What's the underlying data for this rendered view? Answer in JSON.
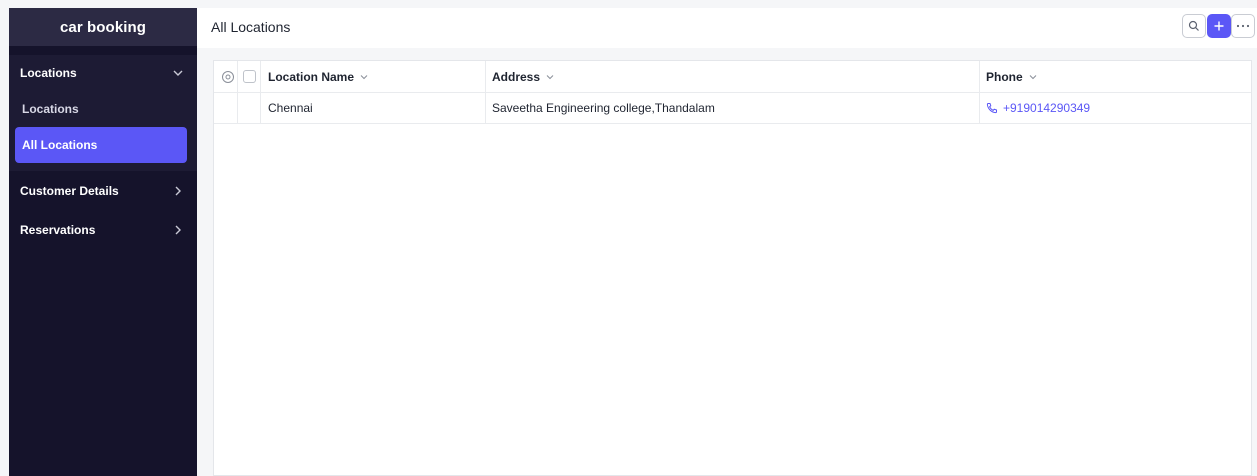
{
  "app": {
    "name": "car booking"
  },
  "sidebar": {
    "groups": [
      {
        "label": "Locations",
        "expanded": true,
        "items": [
          {
            "label": "Locations",
            "active": false
          },
          {
            "label": "All Locations",
            "active": true
          }
        ]
      },
      {
        "label": "Customer Details",
        "expanded": false
      },
      {
        "label": "Reservations",
        "expanded": false
      }
    ]
  },
  "header": {
    "title": "All Locations",
    "icons": [
      "search-icon",
      "plus-icon",
      "more-icon"
    ]
  },
  "table": {
    "columns": [
      "Location Name",
      "Address",
      "Phone"
    ],
    "rows": [
      {
        "location_name": "Chennai",
        "address": "Saveetha Engineering college,Thandalam",
        "phone": "+919014290349"
      }
    ]
  },
  "colors": {
    "accent": "#5b57f6",
    "sidebar_bg": "#15132b",
    "sidebar_header_bg": "#2c2a44"
  }
}
